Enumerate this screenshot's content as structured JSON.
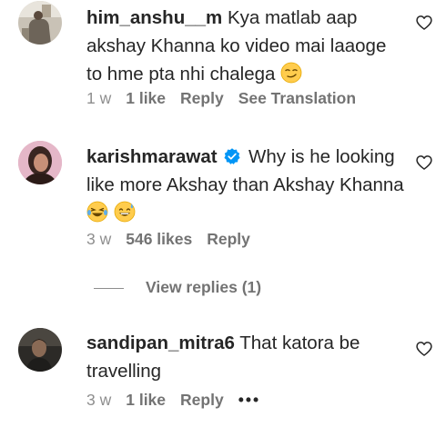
{
  "comments": [
    {
      "username": "him_anshu__m",
      "text": "Kya matlab aap akshay Khanna ko video mai laaoge to hme pta nhi chalega",
      "emoji": "smirk-emoji",
      "time": "1 w",
      "likes": "1 like",
      "reply": "Reply",
      "extra": "See Translation",
      "verified": false,
      "avatar": "avatar-him-anshu"
    },
    {
      "username": "karishmarawat",
      "text": "Why is he looking like more Akshay than Akshay Khanna",
      "emoji": "laughing-crying-emoji, grinning-sweat-emoji",
      "time": "3 w",
      "likes": "546 likes",
      "reply": "Reply",
      "verified": true,
      "avatar": "avatar-karishmarawat"
    },
    {
      "username": "sandipan_mitra6",
      "text": "That katora be travelling",
      "time": "3 w",
      "likes": "1 like",
      "reply": "Reply",
      "more": "•••",
      "verified": false,
      "avatar": "avatar-sandipan"
    }
  ],
  "view_replies": "View replies (1)",
  "icons": {
    "like": "heart-outline-icon",
    "verified": "verified-badge-icon"
  },
  "colors": {
    "text": "#262626",
    "meta": "#8e8e8e",
    "verified": "#0095f6"
  }
}
